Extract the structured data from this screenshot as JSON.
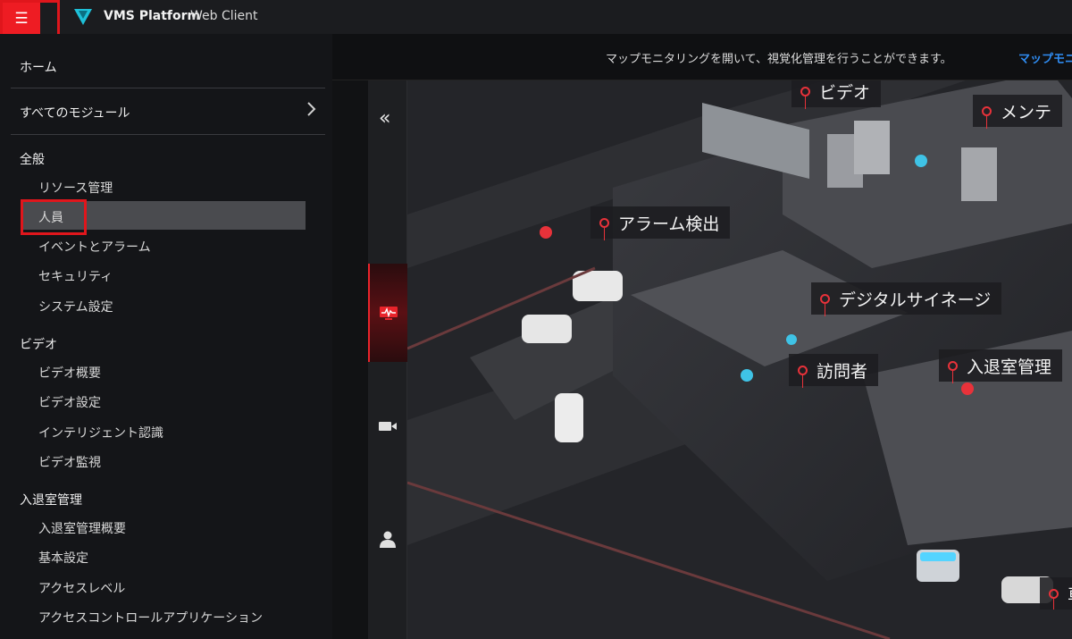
{
  "app": {
    "title": "VMS Platform",
    "subtitle": "Web Client"
  },
  "infostrip": {
    "message": "マップモニタリングを開いて、視覚化管理を行うことができます。",
    "link": "マップモニ"
  },
  "sidemenu": {
    "home": "ホーム",
    "all_modules": "すべてのモジュール",
    "sections": [
      {
        "title": "全般",
        "items": [
          "リソース管理",
          "人員",
          "イベントとアラーム",
          "セキュリティ",
          "システム設定"
        ]
      },
      {
        "title": "ビデオ",
        "items": [
          "ビデオ概要",
          "ビデオ設定",
          "インテリジェント認識",
          "ビデオ監視"
        ]
      },
      {
        "title": "入退室管理",
        "items": [
          "入退室管理概要",
          "基本設定",
          "アクセスレベル",
          "アクセスコントロールアプリケーション"
        ]
      }
    ],
    "active_item": "人員"
  },
  "map": {
    "labels": [
      "ビデオ",
      "メンテ",
      "アラーム検出",
      "デジタルサイネージ",
      "訪問者",
      "入退室管理",
      "車"
    ]
  },
  "colors": {
    "accent": "#ee1c23",
    "link": "#2f8cf2",
    "pin": "#e8323a",
    "topbar": "#1b1c1f"
  },
  "icons": {
    "menu": "hamburger-icon",
    "collapse": "double-chevron-left-icon",
    "monitor": "pulse-monitor-icon",
    "video": "camera-icon",
    "person": "person-icon"
  }
}
